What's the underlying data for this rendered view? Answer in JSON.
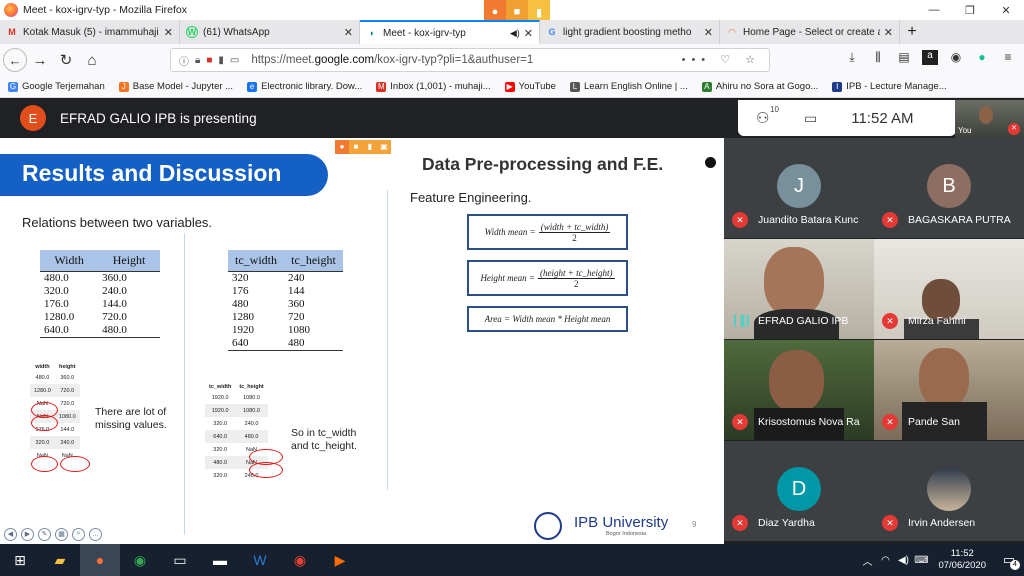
{
  "window": {
    "title": "Meet - kox-igrv-typ - Mozilla Firefox",
    "controls": [
      "minimize-icon",
      "restore-icon",
      "close-icon"
    ]
  },
  "tabs": [
    {
      "label": "Kotak Masuk (5) - imammuhaji",
      "icon": "gmail-icon",
      "icon_char": "M",
      "icon_color": "#d93025"
    },
    {
      "label": "(61) WhatsApp",
      "icon": "whatsapp-icon",
      "icon_char": "W",
      "icon_color": "#25d366"
    },
    {
      "label": "Meet - kox-igrv-typ",
      "icon": "meet-icon",
      "icon_char": "M",
      "icon_color": "#00897b",
      "active": true
    },
    {
      "label": "light gradient boosting metho",
      "icon": "google-icon",
      "icon_char": "G",
      "icon_color": "#4285f4"
    },
    {
      "label": "Home Page - Select or create a",
      "icon": "jupyter-icon",
      "icon_char": "J",
      "icon_color": "#f37626"
    }
  ],
  "url": {
    "prefix": "https://meet.",
    "domain": "google.com",
    "suffix": "/kox-igrv-typ?pli=1&authuser=1",
    "more": "•••"
  },
  "bookmarks": [
    {
      "label": "Google Terjemahan",
      "color": "#4285f4",
      "char": "G"
    },
    {
      "label": "Base Model - Jupyter ...",
      "color": "#f37626",
      "char": "J"
    },
    {
      "label": "Electronic library. Dow...",
      "color": "#1a73e8",
      "char": "e"
    },
    {
      "label": "Inbox (1,001) - muhaji...",
      "color": "#d93025",
      "char": "M"
    },
    {
      "label": "YouTube",
      "color": "#ff0000",
      "char": "▶"
    },
    {
      "label": "Learn English Online | ...",
      "color": "#555",
      "char": "L"
    },
    {
      "label": "Ahiru no Sora at Gogo...",
      "color": "#2e7d32",
      "char": "A"
    },
    {
      "label": "IPB - Lecture Manage...",
      "color": "#1e3a8a",
      "char": "I"
    }
  ],
  "meet": {
    "presenter_initial": "E",
    "presenting_text": "EFRAD GALIO IPB is presenting",
    "participant_count": "10",
    "time": "11:52 AM",
    "self_label": "You"
  },
  "slide": {
    "left_title": "Results and Discussion",
    "right_title": "Data Pre-processing and F.E.",
    "relations": "Relations between two variables.",
    "feature_eng": "Feature Engineering.",
    "table1": {
      "headers": [
        "Width",
        "Height"
      ],
      "rows": [
        [
          "480.0",
          "360.0"
        ],
        [
          "320.0",
          "240.0"
        ],
        [
          "176.0",
          "144.0"
        ],
        [
          "1280.0",
          "720.0"
        ],
        [
          "640.0",
          "480.0"
        ]
      ]
    },
    "table2": {
      "headers": [
        "tc_width",
        "tc_height"
      ],
      "rows": [
        [
          "320",
          "240"
        ],
        [
          "176",
          "144"
        ],
        [
          "480",
          "360"
        ],
        [
          "1280",
          "720"
        ],
        [
          "1920",
          "1080"
        ],
        [
          "640",
          "480"
        ]
      ]
    },
    "mini1": {
      "headers": [
        "width",
        "height"
      ],
      "rows": [
        [
          "480.0",
          "360.0"
        ],
        [
          "1280.0",
          "720.0"
        ],
        [
          "NaN",
          "720.0"
        ],
        [
          "NaN",
          "1080.0"
        ],
        [
          "176.0",
          "144.0"
        ],
        [
          "320.0",
          "240.0"
        ],
        [
          "NaN",
          "NaN"
        ]
      ]
    },
    "mini2": {
      "headers": [
        "tc_width",
        "tc_height"
      ],
      "rows": [
        [
          "1920.0",
          "1080.0"
        ],
        [
          "1920.0",
          "1080.0"
        ],
        [
          "320.0",
          "240.0"
        ],
        [
          "640.0",
          "480.0"
        ],
        [
          "320.0",
          "NaN"
        ],
        [
          "480.0",
          "NaN"
        ],
        [
          "320.0",
          "240.0"
        ]
      ]
    },
    "note1": "There are lot of missing values.",
    "note2": "So in tc_width and tc_height.",
    "formula1": {
      "lhs": "Width mean =",
      "num": "(width + tc_width)",
      "den": "2"
    },
    "formula2": {
      "lhs": "Height mean =",
      "num": "(height + tc_height)",
      "den": "2"
    },
    "formula3": "Area = Width mean * Height mean",
    "logo_text": "IPB University",
    "logo_sub": "Bogor Indonesia",
    "page_number": "9"
  },
  "participants": [
    {
      "name": "Juandito Batara Kunc",
      "initial": "J",
      "color": "#78909c",
      "muted": true,
      "type": "avatar"
    },
    {
      "name": "BAGASKARA PUTRA",
      "initial": "B",
      "color": "#8d6e63",
      "muted": true,
      "type": "avatar"
    },
    {
      "name": "EFRAD GALIO IPB",
      "muted": false,
      "type": "video"
    },
    {
      "name": "Mirza Fahmi",
      "muted": true,
      "type": "video"
    },
    {
      "name": "Krisostomus Nova Ra",
      "muted": true,
      "type": "video"
    },
    {
      "name": "Pande San",
      "muted": true,
      "type": "video"
    },
    {
      "name": "Diaz Yardha",
      "initial": "D",
      "color": "#0097a7",
      "muted": true,
      "type": "avatar"
    },
    {
      "name": "Irvin Andersen",
      "muted": true,
      "type": "photo"
    }
  ],
  "taskbar": {
    "apps": [
      "windows-icon",
      "file-explorer-icon",
      "firefox-icon",
      "chrome-icon",
      "app-icon",
      "terminal-icon",
      "word-icon",
      "chrome-alt-icon",
      "media-icon"
    ],
    "time": "11:52",
    "date": "07/06/2020",
    "notifications": "4"
  }
}
